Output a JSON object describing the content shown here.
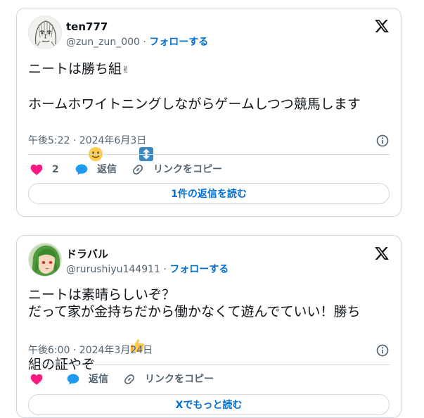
{
  "tweets": [
    {
      "author_name": "ten777",
      "handle": "@zun_zun_000",
      "separator": "·",
      "follow_label": "フォローする",
      "text_line1": "ニートは勝ち組",
      "text_line1_emoji": "✌",
      "text_line2": "ホームホワイトニングしながらゲームしつつ競馬します",
      "text_line2_emojis": [
        "slightly-smiling-face-emoji",
        "up-down-arrow-emoji"
      ],
      "timestamp": "午後5:22 · 2024年6月3日",
      "like_count": "2",
      "reply_label": "返信",
      "copy_link_label": "リンクをコピー",
      "cta_label": "1件の返信を読む",
      "avatar": "sketch-face-avatar"
    },
    {
      "author_name": "ドラバル",
      "handle": "@rurushiyu144911",
      "separator": "·",
      "follow_label": "フォローする",
      "text_line1": "ニートは素晴らしいぞ？",
      "text_line2": "だって家が金持ちだから働かなくて遊んでていい！勝ち",
      "text_line3": "組の証やぞ",
      "text_line3_emoji": "thumbs-up-emoji",
      "timestamp": "午後6:00 · 2024年3月24日",
      "reply_label": "返信",
      "copy_link_label": "リンクをコピー",
      "cta_label": "Xでもっと読む",
      "avatar": "green-hair-anime-avatar"
    }
  ],
  "colors": {
    "link": "#006fd6",
    "heart": "#f91880",
    "reply_bubble": "#1d9bf0",
    "secondary_text": "#536471",
    "border": "#cfd9de"
  },
  "icons": {
    "brand": "x-logo-icon",
    "info": "info-icon",
    "like": "heart-icon",
    "reply": "speech-bubble-icon",
    "copy_link": "link-icon"
  }
}
